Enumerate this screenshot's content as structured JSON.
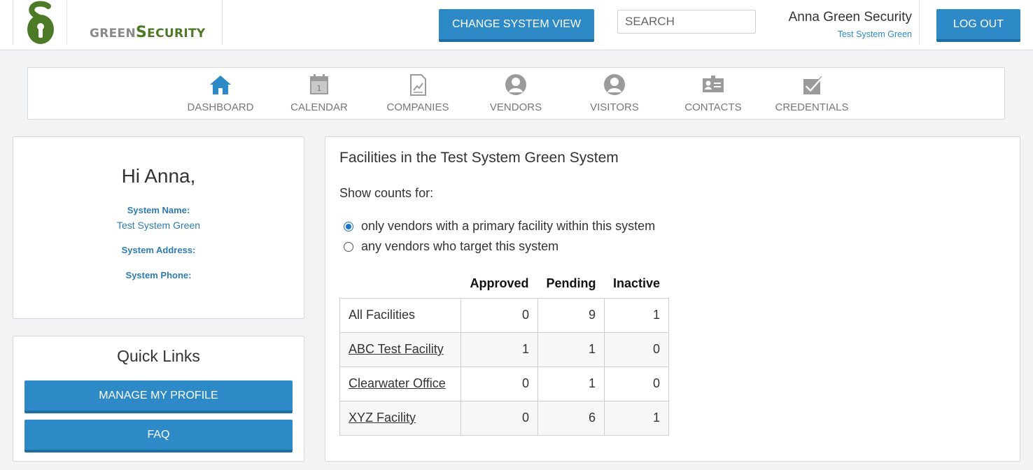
{
  "header": {
    "logo_text_prefix": "GREEN",
    "logo_text_s": "S",
    "logo_text_suffix": "ECURITY",
    "change_view_label": "CHANGE SYSTEM VIEW",
    "search_placeholder": "SEARCH",
    "user_name": "Anna Green Security",
    "user_system": "Test System Green",
    "logout_label": "LOG OUT",
    "brand_color": "#4d7a26",
    "accent_color": "#2e8ac6"
  },
  "nav": {
    "items": [
      {
        "label": "DASHBOARD",
        "icon": "home-icon",
        "active": true
      },
      {
        "label": "CALENDAR",
        "icon": "calendar-icon",
        "calendar_day": "1"
      },
      {
        "label": "COMPANIES",
        "icon": "document-chart-icon"
      },
      {
        "label": "VENDORS",
        "icon": "person-icon"
      },
      {
        "label": "VISITORS",
        "icon": "person-icon"
      },
      {
        "label": "CONTACTS",
        "icon": "id-card-icon"
      },
      {
        "label": "CREDENTIALS",
        "icon": "checkmark-icon"
      }
    ]
  },
  "profile": {
    "greeting": "Hi Anna,",
    "system_name_label": "System Name:",
    "system_name": "Test System Green",
    "system_address_label": "System Address:",
    "system_phone_label": "System Phone:"
  },
  "quick_links": {
    "title": "Quick Links",
    "buttons": [
      "MANAGE MY PROFILE",
      "FAQ"
    ]
  },
  "facilities": {
    "title": "Facilities in the Test System Green System",
    "show_counts_label": "Show counts for:",
    "options": [
      {
        "label": "only vendors with a primary facility within this system",
        "selected": true
      },
      {
        "label": "any vendors who target this system",
        "selected": false
      }
    ],
    "columns": [
      "Approved",
      "Pending",
      "Inactive"
    ],
    "rows": [
      {
        "name": "All Facilities",
        "link": false,
        "approved": "0",
        "pending": "9",
        "inactive": "1"
      },
      {
        "name": "ABC Test Facility",
        "link": true,
        "approved": "1",
        "pending": "1",
        "inactive": "0"
      },
      {
        "name": "Clearwater Office",
        "link": true,
        "approved": "0",
        "pending": "1",
        "inactive": "0"
      },
      {
        "name": "XYZ Facility",
        "link": true,
        "approved": "0",
        "pending": "6",
        "inactive": "1"
      }
    ]
  }
}
